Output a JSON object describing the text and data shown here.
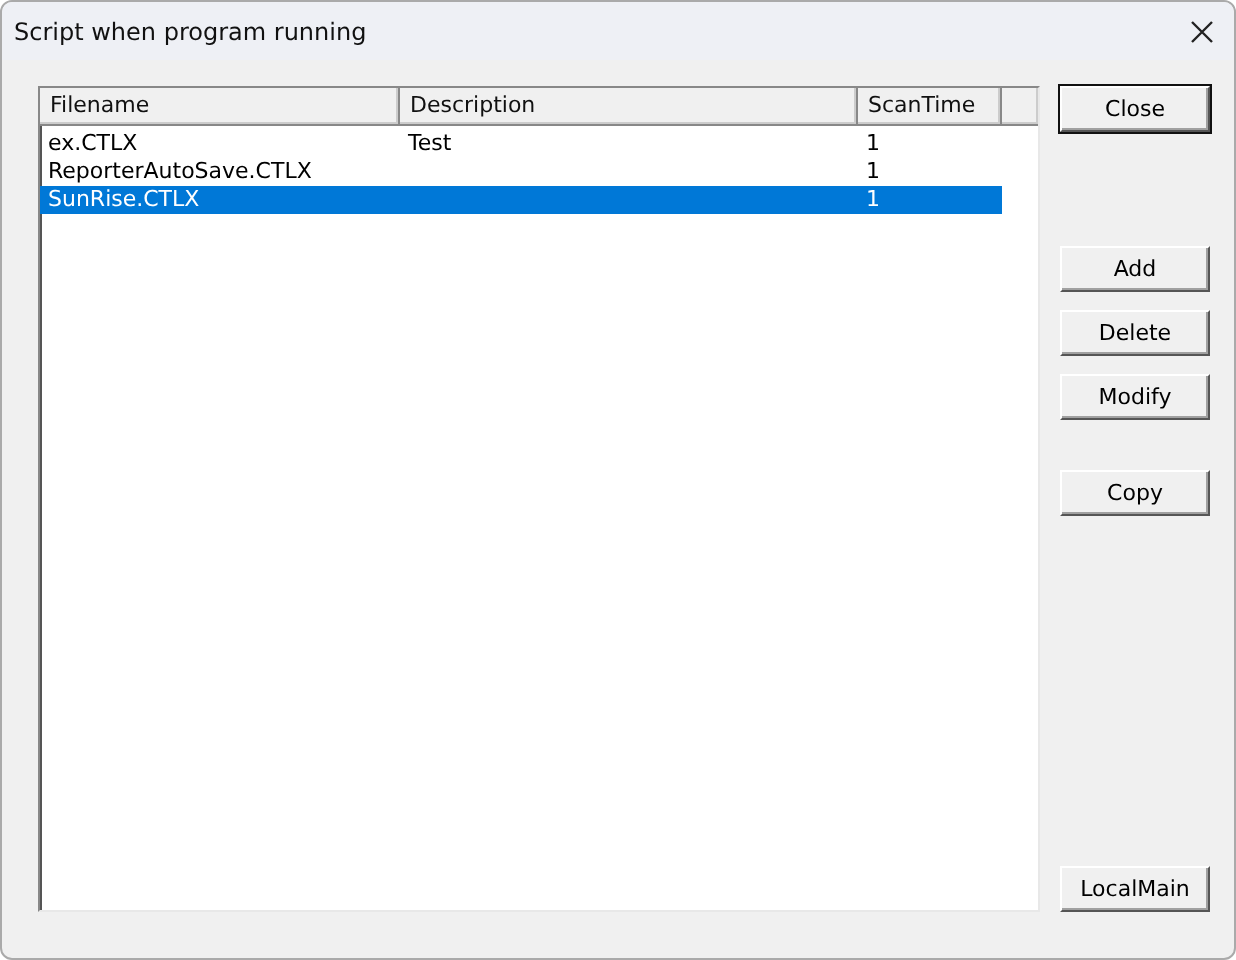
{
  "window": {
    "title": "Script when program running"
  },
  "table": {
    "columns": [
      "Filename",
      "Description",
      "ScanTime"
    ],
    "rows": [
      {
        "cells": [
          "ex.CTLX",
          "Test",
          "1"
        ],
        "selected": false
      },
      {
        "cells": [
          "ReporterAutoSave.CTLX",
          "",
          "1"
        ],
        "selected": false
      },
      {
        "cells": [
          "SunRise.CTLX",
          "",
          "1"
        ],
        "selected": true
      }
    ]
  },
  "buttons": [
    {
      "label": "Close",
      "kind": "default"
    },
    {
      "label": "Add",
      "kind": "group1"
    },
    {
      "label": "Delete",
      "kind": "normal"
    },
    {
      "label": "Modify",
      "kind": "normal"
    },
    {
      "label": "Copy",
      "kind": "group2"
    },
    {
      "label": "LocalMain",
      "kind": "bottom"
    }
  ]
}
